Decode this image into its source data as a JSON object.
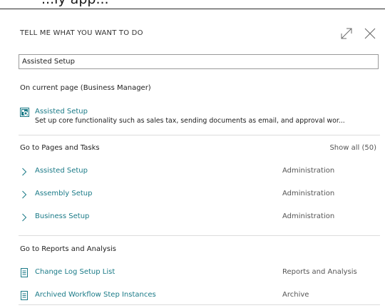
{
  "background_text": "...ly app...",
  "header": {
    "title": "TELL ME WHAT YOU WANT TO DO"
  },
  "icons": {
    "expand": "expand-icon",
    "close": "close-icon",
    "app": "assisted-setup-icon",
    "chevron": "chevron-right-icon",
    "report": "report-document-icon"
  },
  "search": {
    "value": "Assisted Setup"
  },
  "current_page": {
    "title": "On current page (Business Manager)",
    "item": {
      "label": "Assisted Setup",
      "description": "Set up core functionality such as sales tax, sending documents as email, and approval wor..."
    }
  },
  "pages": {
    "title": "Go to Pages and Tasks",
    "show_all": "Show all (50)",
    "items": [
      {
        "label": "Assisted Setup",
        "category": "Administration"
      },
      {
        "label": "Assembly Setup",
        "category": "Administration"
      },
      {
        "label": "Business Setup",
        "category": "Administration"
      }
    ]
  },
  "reports": {
    "title": "Go to Reports and Analysis",
    "items": [
      {
        "label": "Change Log Setup List",
        "category": "Reports and Analysis"
      },
      {
        "label": "Archived Workflow Step Instances",
        "category": "Archive"
      }
    ]
  },
  "colors": {
    "link": "#1a7a87",
    "category": "#555555",
    "divider": "#dcdcdc"
  }
}
